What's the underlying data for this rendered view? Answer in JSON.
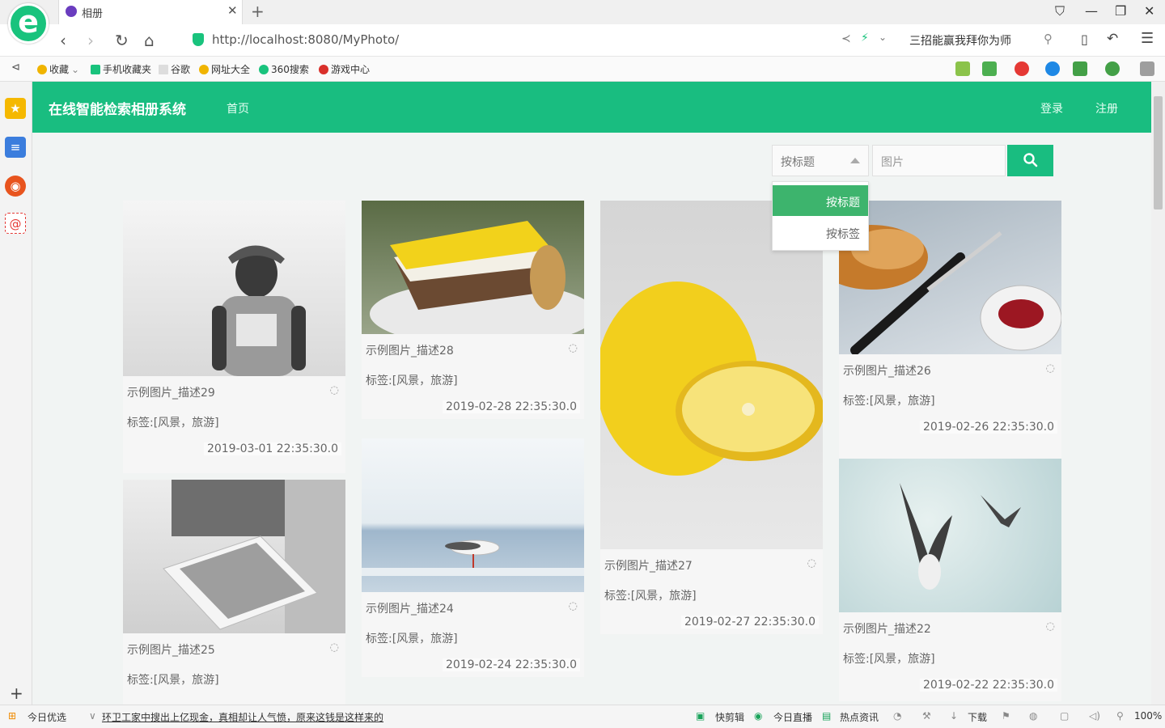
{
  "browser": {
    "tab_title": "相册",
    "url": "http://localhost:8080/MyPhoto/",
    "search_hint": "三招能赢我拜你为师",
    "bookmarks": [
      "收藏",
      "手机收藏夹",
      "谷歌",
      "网址大全",
      "360搜索",
      "游戏中心"
    ]
  },
  "site": {
    "title": "在线智能检索相册系统",
    "nav_home": "首页",
    "nav_login": "登录",
    "nav_register": "注册"
  },
  "search": {
    "mode_selected": "按标题",
    "placeholder": "图片",
    "options": [
      "按标题",
      "按标签"
    ]
  },
  "photos": [
    {
      "desc": "示例图片_描述29",
      "tags": "标签:[风景，旅游]",
      "date": "2019-03-01 22:35:30.0"
    },
    {
      "desc": "示例图片_描述28",
      "tags": "标签:[风景，旅游]",
      "date": "2019-02-28 22:35:30.0"
    },
    {
      "desc": "示例图片_描述27",
      "tags": "标签:[风景，旅游]",
      "date": "2019-02-27 22:35:30.0"
    },
    {
      "desc": "示例图片_描述26",
      "tags": "标签:[风景，旅游]",
      "date": "2019-02-26 22:35:30.0"
    },
    {
      "desc": "示例图片_描述25",
      "tags": "标签:[风景，旅游]",
      "date": ""
    },
    {
      "desc": "示例图片_描述24",
      "tags": "标签:[风景，旅游]",
      "date": "2019-02-24 22:35:30.0"
    },
    {
      "desc": "示例图片_描述22",
      "tags": "标签:[风景，旅游]",
      "date": "2019-02-22 22:35:30.0"
    }
  ],
  "statusbar": {
    "today": "今日优选",
    "news": "环卫工家中搜出上亿现金，真相却让人气愤，原来这钱是这样来的",
    "items": [
      "快剪辑",
      "今日直播",
      "热点资讯",
      "下载"
    ],
    "zoom": "100%"
  },
  "colors": {
    "accent": "#19bd80"
  }
}
